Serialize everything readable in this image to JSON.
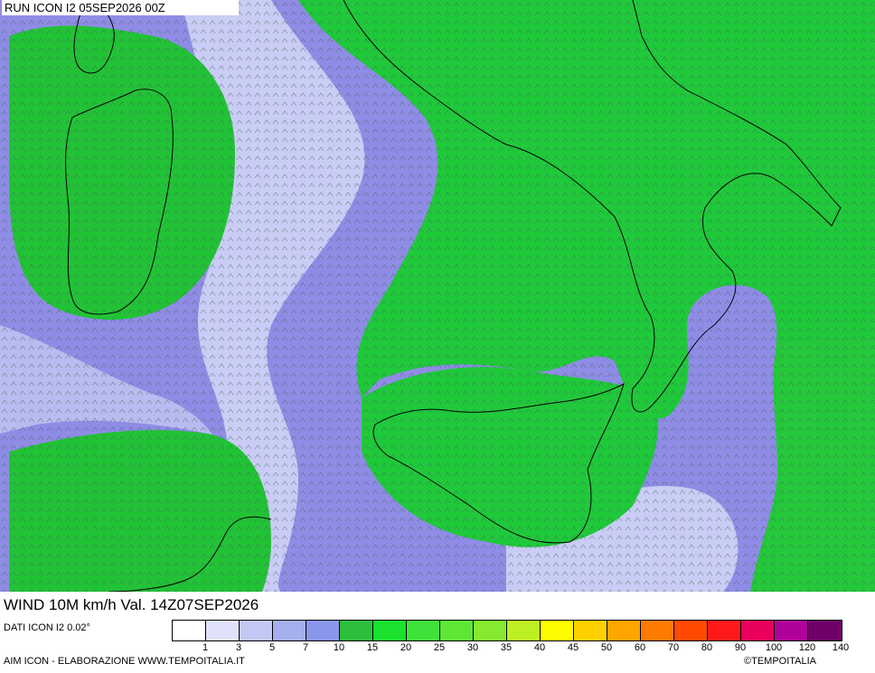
{
  "header": {
    "run_label": "RUN ICON I2 05SEP2026 00Z"
  },
  "footer": {
    "product_title": "WIND 10M km/h Val. 14Z07SEP2026",
    "data_source": "DATI ICON I2 0.02°",
    "credit_left": "AIM ICON - ELABORAZIONE WWW.TEMPOITALIA.IT",
    "credit_right": "©TEMPOITALIA"
  },
  "legend": {
    "ticks": [
      "1",
      "3",
      "5",
      "7",
      "10",
      "15",
      "20",
      "25",
      "30",
      "35",
      "40",
      "45",
      "50",
      "60",
      "70",
      "80",
      "90",
      "100",
      "120",
      "140"
    ],
    "colors": [
      "#ffffff",
      "#dfe2fa",
      "#c3c8f4",
      "#a6afee",
      "#8a96ea",
      "#2dbe3c",
      "#19e12d",
      "#3fe23a",
      "#5ee637",
      "#86ea2f",
      "#bdf022",
      "#fffc00",
      "#ffd000",
      "#ffa500",
      "#ff7a00",
      "#ff4a00",
      "#ff1a1a",
      "#e8005a",
      "#b0009a",
      "#6f006a"
    ]
  },
  "palette": {
    "sea_low": "#8e8ae8",
    "sea_calm": "#c3c6f2",
    "land_wind": "#22cf33",
    "coast": "#000000"
  }
}
